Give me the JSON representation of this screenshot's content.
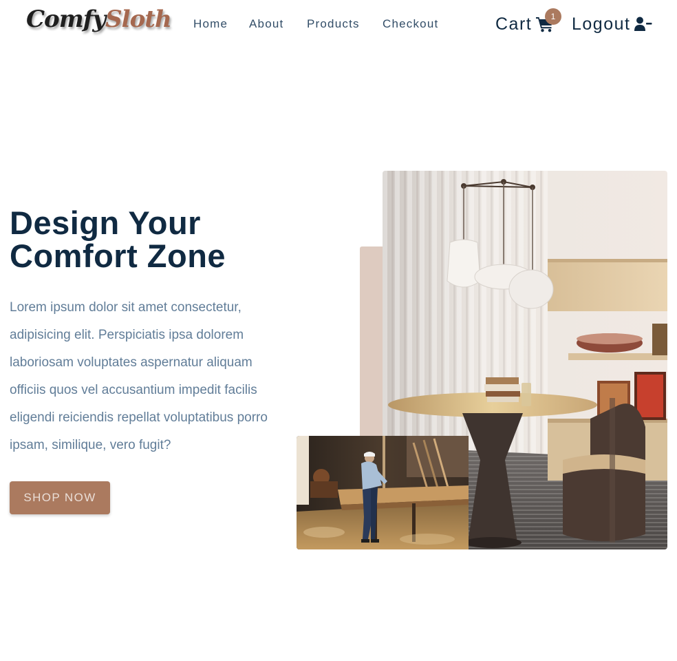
{
  "brand": {
    "logo_part1": "Comfy",
    "logo_part2": "Sloth"
  },
  "nav": {
    "links": [
      {
        "label": "Home"
      },
      {
        "label": "About"
      },
      {
        "label": "Products"
      },
      {
        "label": "Checkout"
      }
    ],
    "cart_label": "Cart",
    "cart_count": "1",
    "logout_label": "Logout"
  },
  "hero": {
    "title_line1": "Design Your",
    "title_line2": "Comfort Zone",
    "description": "Lorem ipsum dolor sit amet consectetur, adipisicing elit. Perspiciatis ipsa dolorem laboriosam voluptates aspernatur aliquam officiis quos vel accusantium impedit facilis eligendi reiciendis repellat voluptatibus porro ipsam, similique, vero fugit?",
    "cta_label": "SHOP NOW"
  },
  "colors": {
    "brand": "#ab7a5f",
    "heading": "#102a42",
    "body_text": "#617d98",
    "accent_block": "#decbc0"
  },
  "icons": [
    "shopping-cart-icon",
    "user-minus-icon"
  ]
}
